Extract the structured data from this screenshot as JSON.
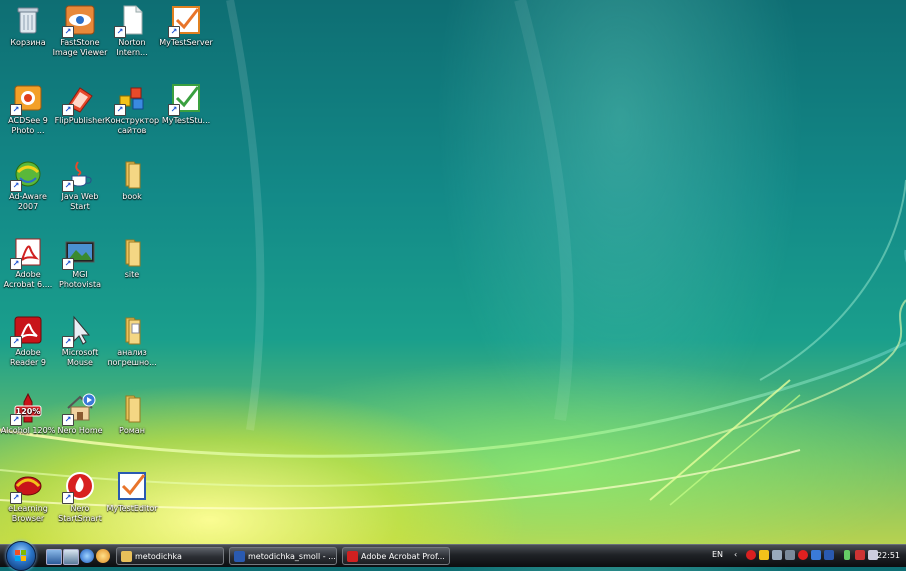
{
  "desktop": {
    "icons": [
      {
        "label": "Корзина",
        "shortcut": false,
        "icon": "recycle-bin-icon"
      },
      {
        "label": "FastStone Image Viewer",
        "shortcut": true,
        "icon": "eye-icon"
      },
      {
        "label": "Norton Intern...",
        "shortcut": true,
        "icon": "document-icon"
      },
      {
        "label": "MyTestServer",
        "shortcut": true,
        "icon": "checkmark-icon"
      },
      {
        "label": "ACDSee 9 Photo ...",
        "shortcut": true,
        "icon": "acdsee-icon"
      },
      {
        "label": "FlipPublisher",
        "shortcut": true,
        "icon": "flip-book-icon"
      },
      {
        "label": "Конструктор сайтов",
        "shortcut": true,
        "icon": "blocks-icon"
      },
      {
        "label": "MyTestStu...",
        "shortcut": true,
        "icon": "checkmark-icon"
      },
      {
        "label": "Ad-Aware 2007",
        "shortcut": true,
        "icon": "globe-icon"
      },
      {
        "label": "Java Web Start",
        "shortcut": true,
        "icon": "java-cup-icon"
      },
      {
        "label": "book",
        "shortcut": false,
        "icon": "folder-icon"
      },
      {
        "label": "Adobe Acrobat 6....",
        "shortcut": true,
        "icon": "acrobat-icon"
      },
      {
        "label": "MGI Photovista",
        "shortcut": true,
        "icon": "panorama-icon"
      },
      {
        "label": "site",
        "shortcut": false,
        "icon": "folder-icon"
      },
      {
        "label": "Adobe Reader 9",
        "shortcut": true,
        "icon": "adobe-reader-icon"
      },
      {
        "label": "Microsoft Mouse",
        "shortcut": true,
        "icon": "mouse-pointer-icon"
      },
      {
        "label": "анализ погрешно...",
        "shortcut": false,
        "icon": "folder-icon"
      },
      {
        "label": "Alcohol 120%",
        "shortcut": true,
        "icon": "alcohol-icon"
      },
      {
        "label": "Nero Home",
        "shortcut": true,
        "icon": "house-icon"
      },
      {
        "label": "Роман",
        "shortcut": false,
        "icon": "folder-icon"
      },
      {
        "label": "eLearning Browser",
        "shortcut": true,
        "icon": "elearning-icon"
      },
      {
        "label": "Nero StartSmart",
        "shortcut": true,
        "icon": "nero-icon"
      },
      {
        "label": "MyTestEditor",
        "shortcut": false,
        "icon": "checkmark-icon"
      }
    ]
  },
  "taskbar": {
    "buttons": [
      {
        "label": "metodichka",
        "icon": "folder-icon"
      },
      {
        "label": "metodichka_smoll - ...",
        "icon": "word-document-icon"
      },
      {
        "label": "Adobe Acrobat Prof...",
        "icon": "acrobat-icon"
      }
    ],
    "tray": {
      "language": "EN",
      "clock": "22:51"
    }
  },
  "colors": {
    "taskbar": "#1f2226",
    "start_orb": "#2a74c8",
    "desktop_teal": "#138a88",
    "desktop_yellow": "#c9d64a"
  }
}
